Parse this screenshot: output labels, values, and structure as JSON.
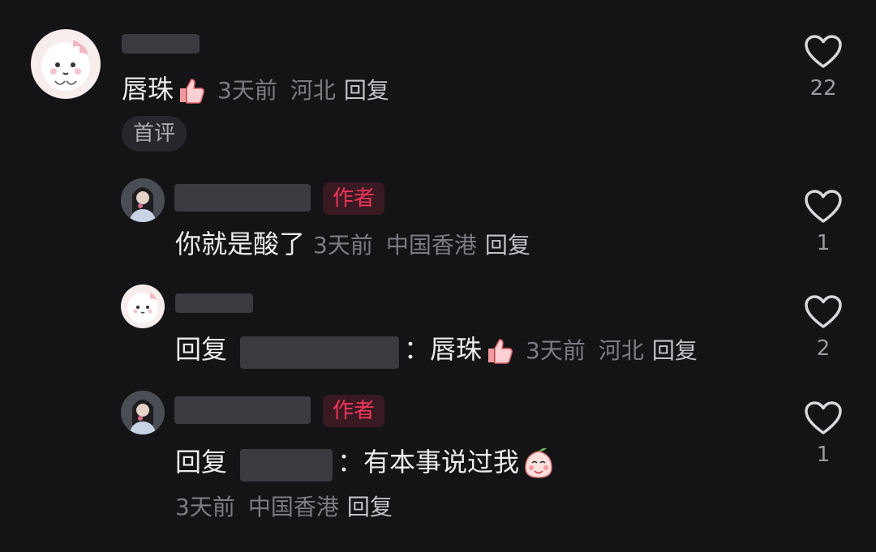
{
  "comments": [
    {
      "comment_text": "唇珠",
      "time": "3天前",
      "location": "河北",
      "reply_label": "回复",
      "badge": "首评",
      "likes": "22"
    },
    {
      "comment_text": "你就是酸了",
      "time": "3天前",
      "location": "中国香港",
      "reply_label": "回复",
      "author_badge": "作者",
      "likes": "1"
    },
    {
      "prefix": "回复",
      "separator": "：",
      "comment_text": "唇珠",
      "time": "3天前",
      "location": "河北",
      "reply_label": "回复",
      "likes": "2"
    },
    {
      "prefix": "回复",
      "separator": "：",
      "comment_text": "有本事说过我",
      "time": "3天前",
      "location": "中国香港",
      "reply_label": "回复",
      "author_badge": "作者",
      "likes": "1"
    }
  ],
  "icons": {
    "like": "heart-outline-icon",
    "thumbs_up_emoji": "thumbs-up-emoji",
    "peach_emoji": "shy-peach-emoji"
  },
  "colors": {
    "background": "#141416",
    "author_badge_text": "#f0365a",
    "author_badge_bg": "#3a1a22",
    "meta_text": "#7b7c82"
  }
}
